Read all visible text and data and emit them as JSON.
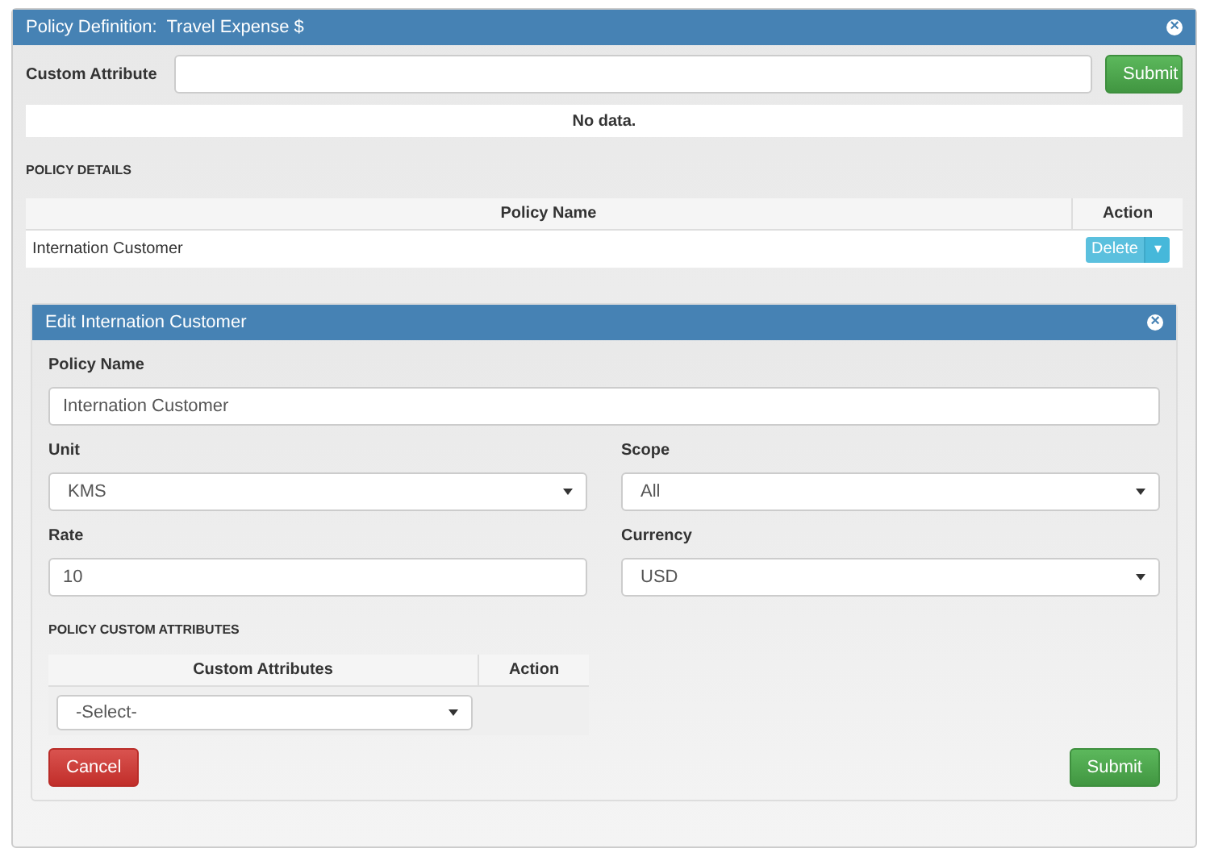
{
  "panel": {
    "title_label": "Policy Definition:",
    "title_value": "Travel Expense $",
    "close": "×"
  },
  "custom_attribute": {
    "label": "Custom Attribute",
    "submit": "Submit"
  },
  "no_data": "No data.",
  "policy_details": {
    "heading": "POLICY DETAILS",
    "columns": [
      "Policy Name",
      "Action"
    ],
    "rows": [
      {
        "name": "Internation Customer",
        "action": "Delete",
        "caret": "▾"
      }
    ]
  },
  "edit": {
    "title": "Edit Internation Customer",
    "close": "×",
    "fields": [
      {
        "kind": "input",
        "label": "Policy Name",
        "value": "Internation Customer",
        "wide": true
      },
      {
        "kind": "select",
        "label": "Unit",
        "value": "KMS",
        "wide": false
      },
      {
        "kind": "select",
        "label": "Scope",
        "value": "All",
        "wide": false
      },
      {
        "kind": "input",
        "label": "Rate",
        "value": "10",
        "wide": false
      },
      {
        "kind": "select",
        "label": "Currency",
        "value": "USD",
        "wide": false
      }
    ],
    "custom_heading": "POLICY CUSTOM ATTRIBUTES",
    "custom_columns": [
      "Custom Attributes",
      "Action"
    ],
    "custom_select": "-Select-",
    "cancel": "Cancel",
    "submit": "Submit"
  }
}
